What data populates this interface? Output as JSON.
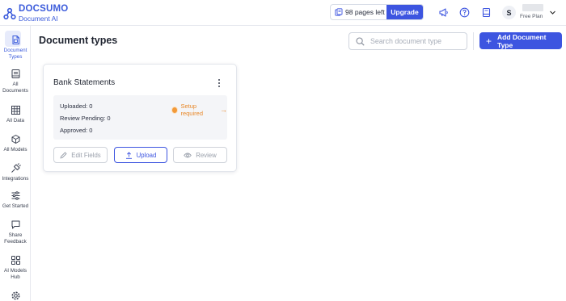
{
  "brand": {
    "name": "DOCSUMO",
    "sub": "Document AI",
    "accent": "#3b5bdb"
  },
  "header": {
    "pages_left": "98 pages left",
    "upgrade_label": "Upgrade",
    "icons": [
      "megaphone-icon",
      "help-icon",
      "book-icon"
    ],
    "user_initial": "S",
    "plan": "Free Plan"
  },
  "sidebar": {
    "items": [
      {
        "label": "Document Types",
        "icon": "document-types-icon",
        "active": true
      },
      {
        "label": "All Documents",
        "icon": "all-documents-icon"
      },
      {
        "label": "All Data",
        "icon": "table-icon"
      },
      {
        "label": "All Models",
        "icon": "cube-icon"
      },
      {
        "label": "Integrations",
        "icon": "plug-icon"
      },
      {
        "label": "Get Started",
        "icon": "sliders-icon"
      },
      {
        "label": "Share Feedback",
        "icon": "chat-icon"
      },
      {
        "label": "AI Models Hub",
        "icon": "grid-icon"
      },
      {
        "label": "",
        "icon": "settings-icon"
      }
    ]
  },
  "main": {
    "title": "Document types",
    "search_placeholder": "Search document type",
    "add_button_label": "Add Document Type"
  },
  "card": {
    "title": "Bank Statements",
    "uploaded": "Uploaded:  0",
    "review_pending": "Review Pending:  0",
    "approved": "Approved:  0",
    "setup_status": "Setup required",
    "buttons": {
      "edit": "Edit Fields",
      "upload": "Upload",
      "review": "Review"
    }
  }
}
